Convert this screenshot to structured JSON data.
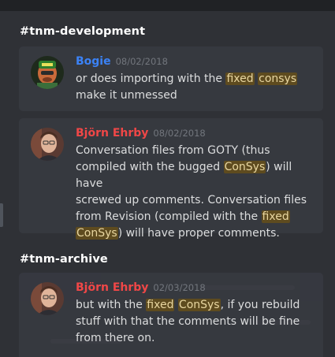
{
  "sections": [
    {
      "channel": "#tnm-development",
      "messages": [
        {
          "author": "Bogie",
          "timestamp": "08/02/2018",
          "lines": [
            [
              {
                "t": "or does importing with the "
              },
              {
                "t": "fixed",
                "hl": true
              },
              {
                "t": " "
              },
              {
                "t": "consys",
                "hl": true
              }
            ],
            [
              {
                "t": "make it unmessed"
              }
            ]
          ]
        },
        {
          "author": "Björn Ehrby",
          "timestamp": "08/02/2018",
          "lines": [
            [
              {
                "t": "Conversation files from GOTY (thus"
              }
            ],
            [
              {
                "t": "compiled with the bugged "
              },
              {
                "t": "ConSys",
                "hl": true
              },
              {
                "t": ") will have"
              }
            ],
            [
              {
                "t": "screwed up comments. Conversation files"
              }
            ],
            [
              {
                "t": "from Revision (compiled with the "
              },
              {
                "t": "fixed",
                "hl": true
              }
            ],
            [
              {
                "t": "ConSys",
                "hl": true
              },
              {
                "t": ") will have proper comments."
              }
            ]
          ]
        }
      ]
    },
    {
      "channel": "#tnm-archive",
      "messages": [
        {
          "author": "Björn Ehrby",
          "timestamp": "02/03/2018",
          "lines": [
            [
              {
                "t": "but with the "
              },
              {
                "t": "fixed",
                "hl": true
              },
              {
                "t": " "
              },
              {
                "t": "ConSys",
                "hl": true
              },
              {
                "t": ", if you rebuild"
              }
            ],
            [
              {
                "t": "stuff with that the comments will be fine"
              }
            ],
            [
              {
                "t": "from there on."
              }
            ]
          ]
        }
      ]
    }
  ],
  "colors": {
    "background": "#2f3136",
    "card": "#36393f",
    "author_bogie": "#3b82f6",
    "author_bjorn": "#f04747",
    "highlight": "#5e4b1f"
  },
  "icons": [
    "bogie-avatar-icon",
    "bjorn-avatar-icon"
  ]
}
